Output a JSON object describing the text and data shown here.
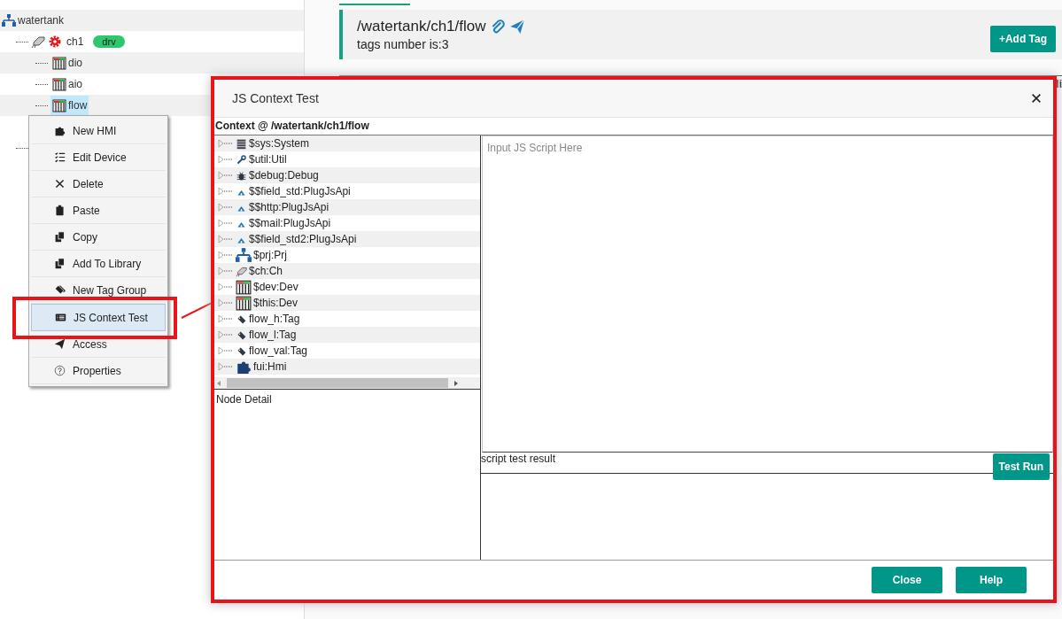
{
  "left_tree": [
    {
      "label": "watertank",
      "kind": "project",
      "selected": false,
      "children": [
        {
          "label": "ch1",
          "kind": "channel",
          "driver_flag": true,
          "badge": "drv",
          "selected": false,
          "children": [
            {
              "label": "dio",
              "kind": "device",
              "selected": false
            },
            {
              "label": "aio",
              "kind": "device",
              "selected": false
            },
            {
              "label": "flow",
              "kind": "device",
              "selected": true
            }
          ]
        },
        {
          "kind": "hmi"
        }
      ]
    }
  ],
  "header": {
    "title": "/watertank/ch1/flow",
    "subtitle": "tags number is:3",
    "add_button": "+Add Tag"
  },
  "table": {
    "columns": [
      "li"
    ]
  },
  "context_menu": [
    {
      "label": "New HMI",
      "kind": "puzzle",
      "selected": false
    },
    {
      "label": "Edit Device",
      "kind": "checklist",
      "selected": false
    },
    {
      "label": "Delete",
      "kind": "close",
      "selected": false
    },
    {
      "label": "Paste",
      "kind": "clipboard",
      "selected": false
    },
    {
      "label": "Copy",
      "kind": "copy",
      "selected": false
    },
    {
      "label": "Add To Library",
      "kind": "copy",
      "selected": false
    },
    {
      "label": "New Tag Group",
      "kind": "tags",
      "selected": false
    },
    {
      "label": "JS Context Test",
      "kind": "list",
      "selected": true
    },
    {
      "label": "Access",
      "kind": "send",
      "selected": false
    },
    {
      "label": "Properties",
      "kind": "question",
      "selected": false
    }
  ],
  "dialog": {
    "title": "JS Context Test",
    "context_label": "Context @ /watertank/ch1/flow",
    "context_tree": [
      {
        "label": "$sys:System",
        "kind": "system"
      },
      {
        "label": "$util:Util",
        "kind": "util"
      },
      {
        "label": "$debug:Debug",
        "kind": "debug"
      },
      {
        "label": "$$field_std:PlugJsApi",
        "kind": "plugin"
      },
      {
        "label": "$$http:PlugJsApi",
        "kind": "plugin"
      },
      {
        "label": "$$mail:PlugJsApi",
        "kind": "plugin"
      },
      {
        "label": "$$field_std2:PlugJsApi",
        "kind": "plugin"
      },
      {
        "label": "$prj:Prj",
        "kind": "project"
      },
      {
        "label": "$ch:Ch",
        "kind": "channel"
      },
      {
        "label": "$dev:Dev",
        "kind": "device"
      },
      {
        "label": "$this:Dev",
        "kind": "device"
      },
      {
        "label": "flow_h:Tag",
        "kind": "tag"
      },
      {
        "label": "flow_l:Tag",
        "kind": "tag"
      },
      {
        "label": "flow_val:Tag",
        "kind": "tag"
      },
      {
        "label": "fui:Hmi",
        "kind": "hmi"
      }
    ],
    "node_detail_label": "Node Detail",
    "script": {
      "placeholder": "Input JS Script Here"
    },
    "result_label": "script test result",
    "test_button": "Test Run",
    "buttons": [
      "Close",
      "Help"
    ]
  }
}
